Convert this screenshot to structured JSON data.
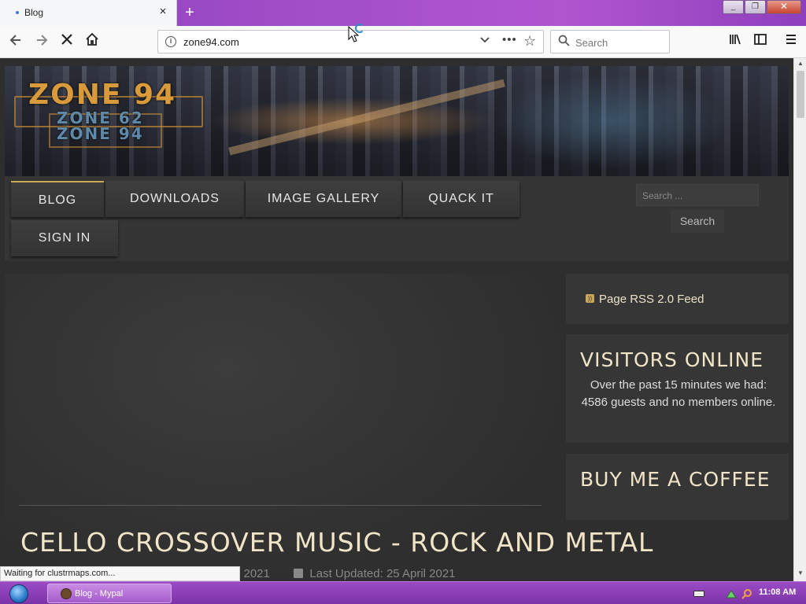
{
  "browser": {
    "tab_title": "Blog",
    "tab_close": "×",
    "new_tab": "+",
    "url": "zone94.com",
    "search_placeholder": "Search",
    "window_buttons": [
      "_",
      "❐",
      "✕"
    ]
  },
  "site": {
    "logo_main": "ZONE 94",
    "logo_sub_1": "ZONE 62",
    "logo_sub_2": "ZONE 94",
    "menu": [
      "BLOG",
      "DOWNLOADS",
      "IMAGE GALLERY",
      "QUACK IT",
      "SIGN IN"
    ],
    "search_placeholder": "Search ...",
    "search_button": "Search"
  },
  "article": {
    "title": "CELLO CROSSOVER MUSIC - ROCK AND METAL",
    "created_fragment": "l 2021",
    "updated": "Last Updated: 25 April 2021"
  },
  "sidebar": {
    "rss_label": "Page RSS 2.0 Feed",
    "visitors_title": "VISITORS ONLINE",
    "visitors_text": "Over the past 15 minutes we had: 4586 guests and no members online.",
    "coffee_title": "BUY ME A COFFEE"
  },
  "status_text": "Waiting for clustrmaps.com...",
  "taskbar": {
    "task_label": "Blog - Mypal",
    "clock": "11:08 AM"
  },
  "icons": [
    "info-icon",
    "chevron-down-icon",
    "more-dots-icon",
    "bookmark-star-icon",
    "search-icon",
    "back-icon",
    "forward-icon",
    "stop-icon",
    "home-icon",
    "library-icon",
    "sidebar-icon",
    "hamburger-menu-icon",
    "rss-icon",
    "calendar-icon",
    "windows-start-icon"
  ],
  "colors": {
    "chrome_purple": "#8e3fbd",
    "page_bg": "#2e2e2e",
    "heading_cream": "#f1e4c7",
    "active_menu_accent": "#c9a85a"
  }
}
